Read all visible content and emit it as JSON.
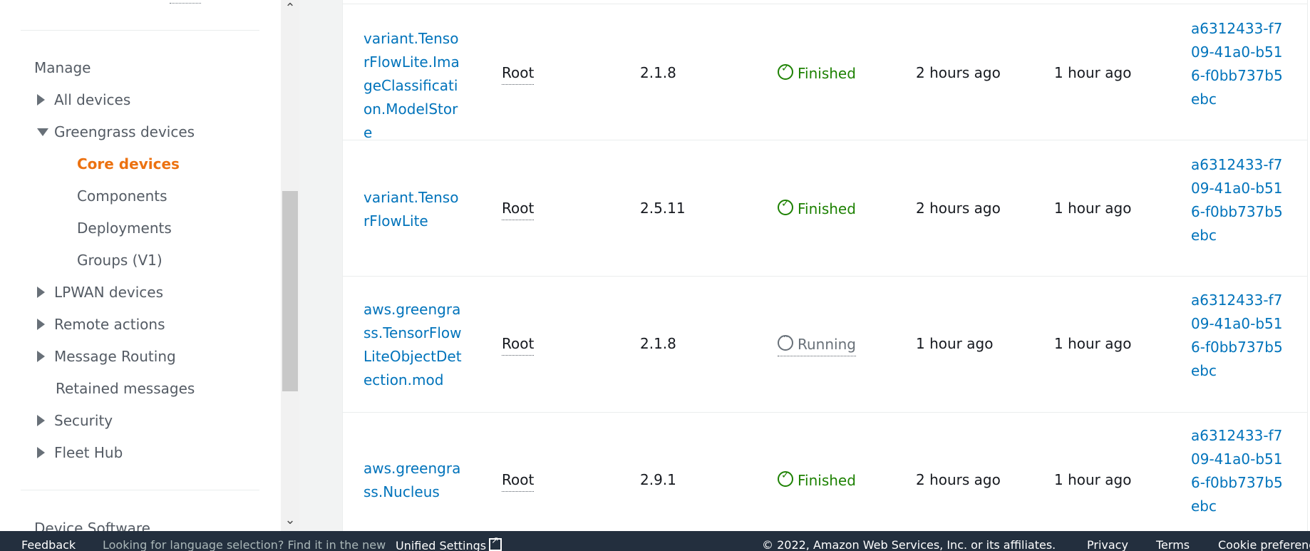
{
  "sidebar": {
    "heading_manage": "Manage",
    "items": [
      {
        "label": "All devices"
      },
      {
        "label": "Greengrass devices"
      },
      {
        "label": "Core devices"
      },
      {
        "label": "Components"
      },
      {
        "label": "Deployments"
      },
      {
        "label": "Groups (V1)"
      },
      {
        "label": "LPWAN devices"
      },
      {
        "label": "Remote actions"
      },
      {
        "label": "Message Routing"
      },
      {
        "label": "Retained messages"
      },
      {
        "label": "Security"
      },
      {
        "label": "Fleet Hub"
      }
    ],
    "heading_device_software": "Device Software"
  },
  "scrollbar": {
    "up_icon": "chevron-up-icon",
    "down_icon": "chevron-down-icon"
  },
  "table": {
    "rows": [
      {
        "component": "variant.TensorFlowLite.ImageClassification.ModelStore",
        "owner": "Root",
        "version": "2.1.8",
        "status": "Finished",
        "created": "2 hours ago",
        "updated": "1 hour ago",
        "deployment": "a6312433-f709-41a0-b516-f0bb737b5ebc"
      },
      {
        "component": "variant.TensorFlowLite",
        "owner": "Root",
        "version": "2.5.11",
        "status": "Finished",
        "created": "2 hours ago",
        "updated": "1 hour ago",
        "deployment": "a6312433-f709-41a0-b516-f0bb737b5ebc"
      },
      {
        "component": "aws.greengrass.TensorFlowLiteObjectDetection.mod",
        "owner": "Root",
        "version": "2.1.8",
        "status": "Running",
        "created": "1 hour ago",
        "updated": "1 hour ago",
        "deployment": "a6312433-f709-41a0-b516-f0bb737b5ebc"
      },
      {
        "component": "aws.greengrass.Nucleus",
        "owner": "Root",
        "version": "2.9.1",
        "status": "Finished",
        "created": "2 hours ago",
        "updated": "1 hour ago",
        "deployment": "a6312433-f709-41a0-b516-f0bb737b5ebc"
      }
    ]
  },
  "footer": {
    "feedback": "Feedback",
    "language_prompt": "Looking for language selection? Find it in the new",
    "unified_settings": "Unified Settings",
    "copyright": "© 2022, Amazon Web Services, Inc. or its affiliates.",
    "privacy": "Privacy",
    "terms": "Terms",
    "cookie": "Cookie preferences"
  },
  "colors": {
    "link": "#0073bb",
    "active_nav": "#ec7211",
    "success": "#1d8102",
    "footer_bg": "#232f3e"
  }
}
